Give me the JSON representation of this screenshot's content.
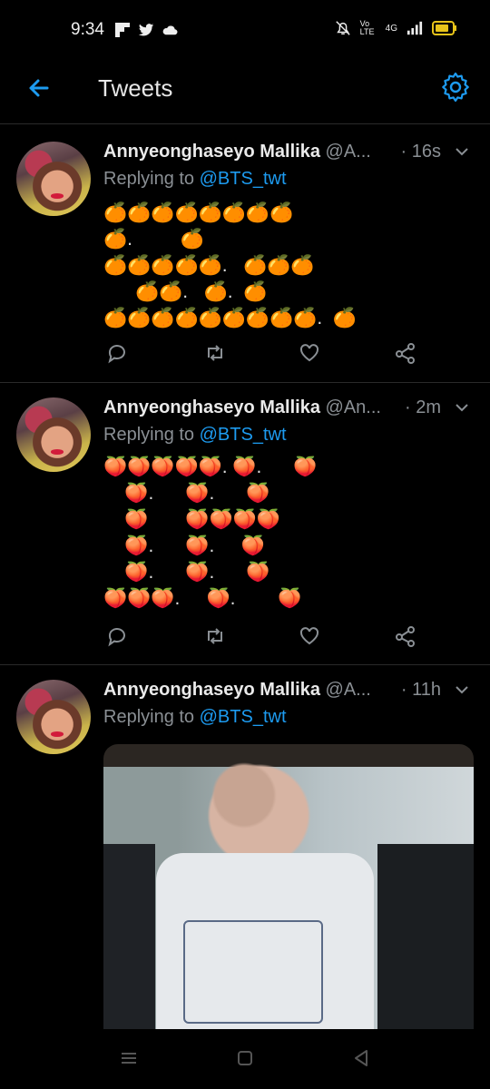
{
  "status_bar": {
    "time": "9:34",
    "network": "4G",
    "volte": "Vo LTE"
  },
  "header": {
    "title": "Tweets"
  },
  "tweets": [
    {
      "name": "Annyeonghaseyo Mallika",
      "handle": "@A...",
      "time": "· 16s",
      "reply_prefix": "Replying to ",
      "reply_mention": "@BTS_twt",
      "text": "🍊🍊🍊🍊🍊🍊🍊🍊\n🍊.         🍊\n🍊🍊🍊🍊🍊.   🍊🍊🍊\n      🍊🍊.   🍊.  🍊\n🍊🍊🍊🍊🍊🍊🍊🍊🍊.  🍊"
    },
    {
      "name": "Annyeonghaseyo Mallika",
      "handle": "@An...",
      "time": "· 2m",
      "reply_prefix": "Replying to ",
      "reply_mention": "@BTS_twt",
      "text": "🍑🍑🍑🍑🍑. 🍑.      🍑\n    🍑.      🍑.      🍑\n    🍑       🍑🍑🍑🍑\n    🍑.      🍑.     🍑\n    🍑.      🍑.      🍑\n🍑🍑🍑.     🍑.        🍑"
    },
    {
      "name": "Annyeonghaseyo Mallika",
      "handle": "@A...",
      "time": "· 11h",
      "reply_prefix": "Replying to ",
      "reply_mention": "@BTS_twt"
    }
  ],
  "icons": {
    "reply": "reply-icon",
    "retweet": "retweet-icon",
    "like": "heart-icon",
    "share": "share-icon"
  },
  "colors": {
    "accent": "#1d9bf0",
    "background": "#000000",
    "muted": "#8a8f94"
  }
}
